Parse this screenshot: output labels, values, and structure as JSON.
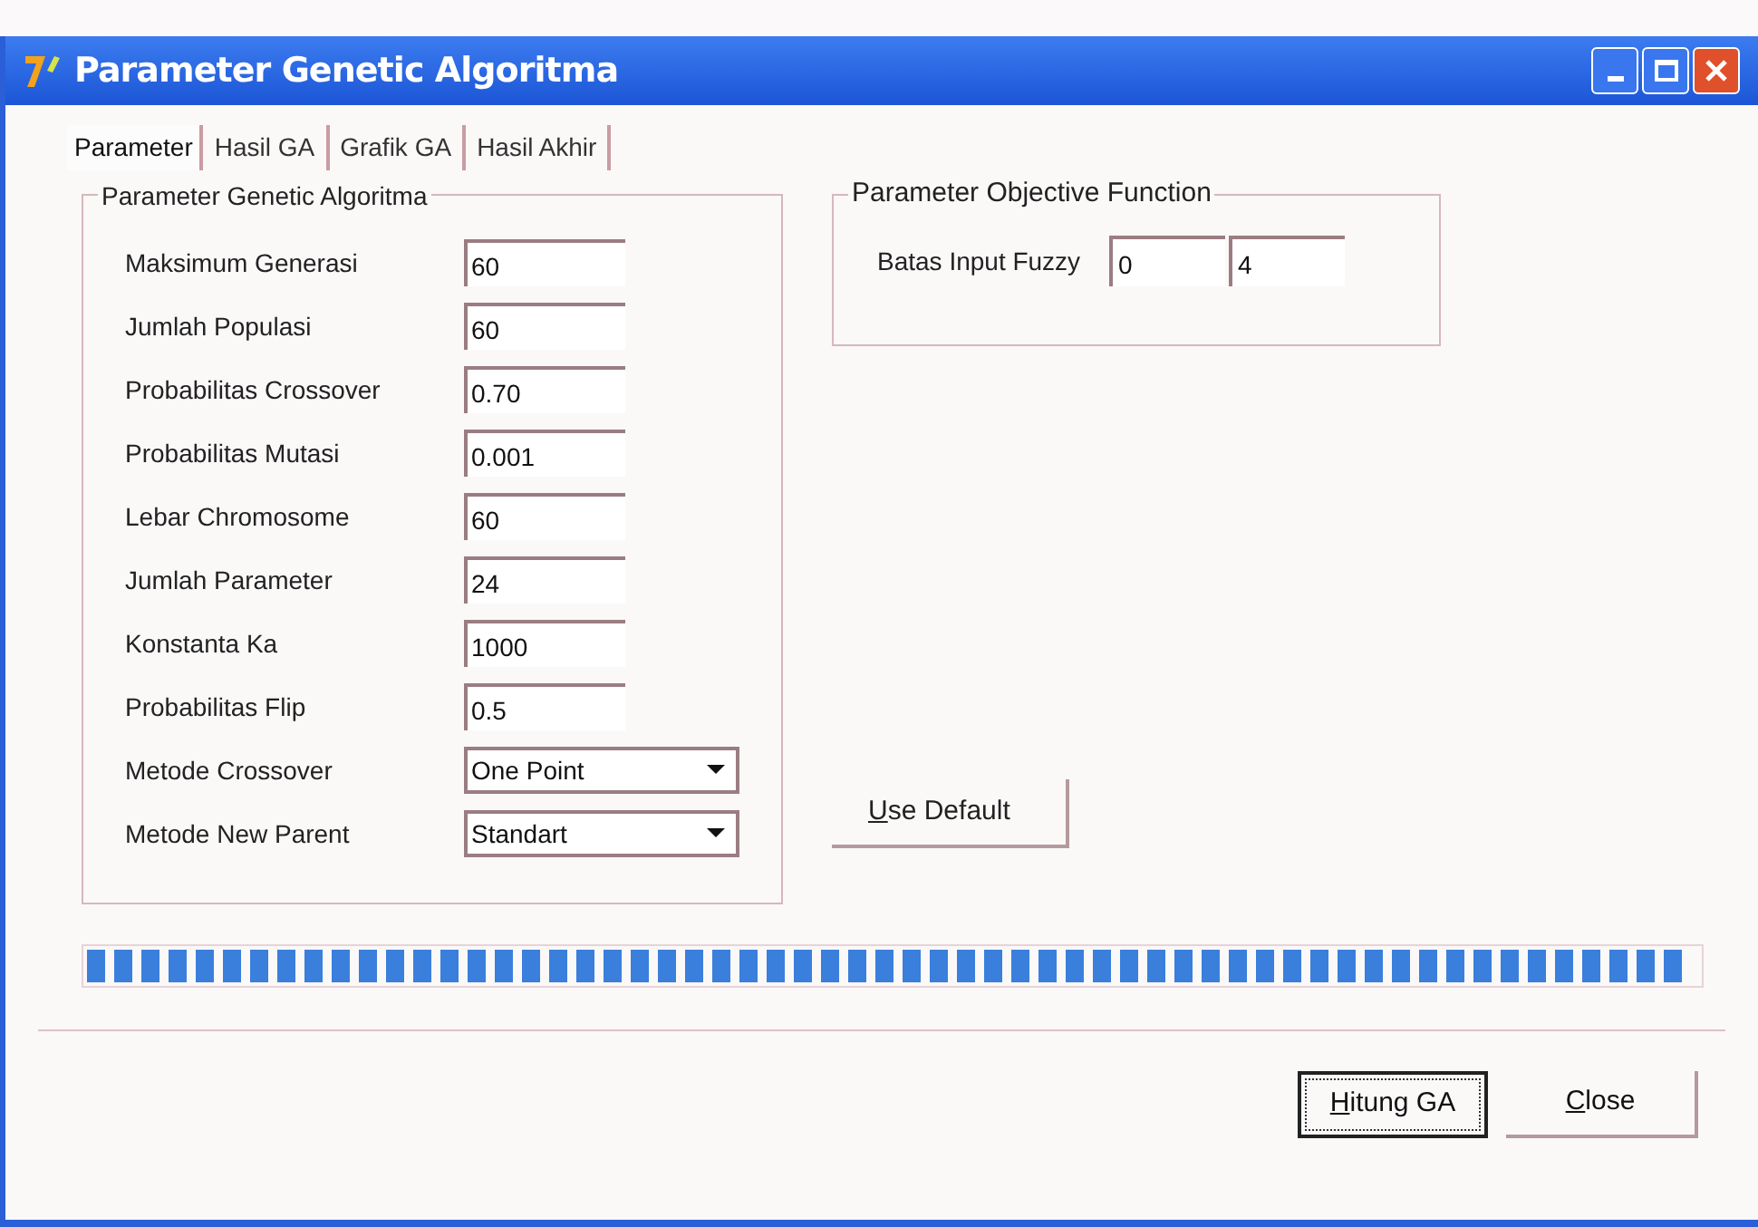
{
  "window": {
    "title": "Parameter Genetic Algoritma"
  },
  "tabs": [
    {
      "label": "Parameter",
      "selected": true
    },
    {
      "label": "Hasil GA",
      "selected": false
    },
    {
      "label": "Grafik GA",
      "selected": false
    },
    {
      "label": "Hasil Akhir",
      "selected": false
    }
  ],
  "ga_group": {
    "title": "Parameter Genetic Algoritma",
    "fields": [
      {
        "kind": "text",
        "label": "Maksimum Generasi",
        "value": "60"
      },
      {
        "kind": "text",
        "label": "Jumlah Populasi",
        "value": "60"
      },
      {
        "kind": "text",
        "label": "Probabilitas Crossover",
        "value": "0.70"
      },
      {
        "kind": "text",
        "label": "Probabilitas Mutasi",
        "value": "0.001"
      },
      {
        "kind": "text",
        "label": "Lebar Chromosome",
        "value": "60"
      },
      {
        "kind": "text",
        "label": "Jumlah Parameter",
        "value": "24"
      },
      {
        "kind": "text",
        "label": "Konstanta Ka",
        "value": "1000"
      },
      {
        "kind": "text",
        "label": "Probabilitas Flip",
        "value": "0.5"
      },
      {
        "kind": "dropdown",
        "label": "Metode Crossover",
        "value": "One Point"
      },
      {
        "kind": "dropdown",
        "label": "Metode New Parent",
        "value": "Standart"
      }
    ]
  },
  "objective_group": {
    "title": "Parameter Objective Function",
    "label": "Batas Input Fuzzy",
    "values": [
      "0",
      "4"
    ]
  },
  "use_default_button": {
    "label": "Use Default",
    "underline_first": true
  },
  "progress": {
    "level": 1
  },
  "buttons": [
    {
      "label": "Hitung GA",
      "underline_first": true,
      "focused": true
    },
    {
      "label": "Close",
      "underline_first": true,
      "focused": false
    }
  ]
}
